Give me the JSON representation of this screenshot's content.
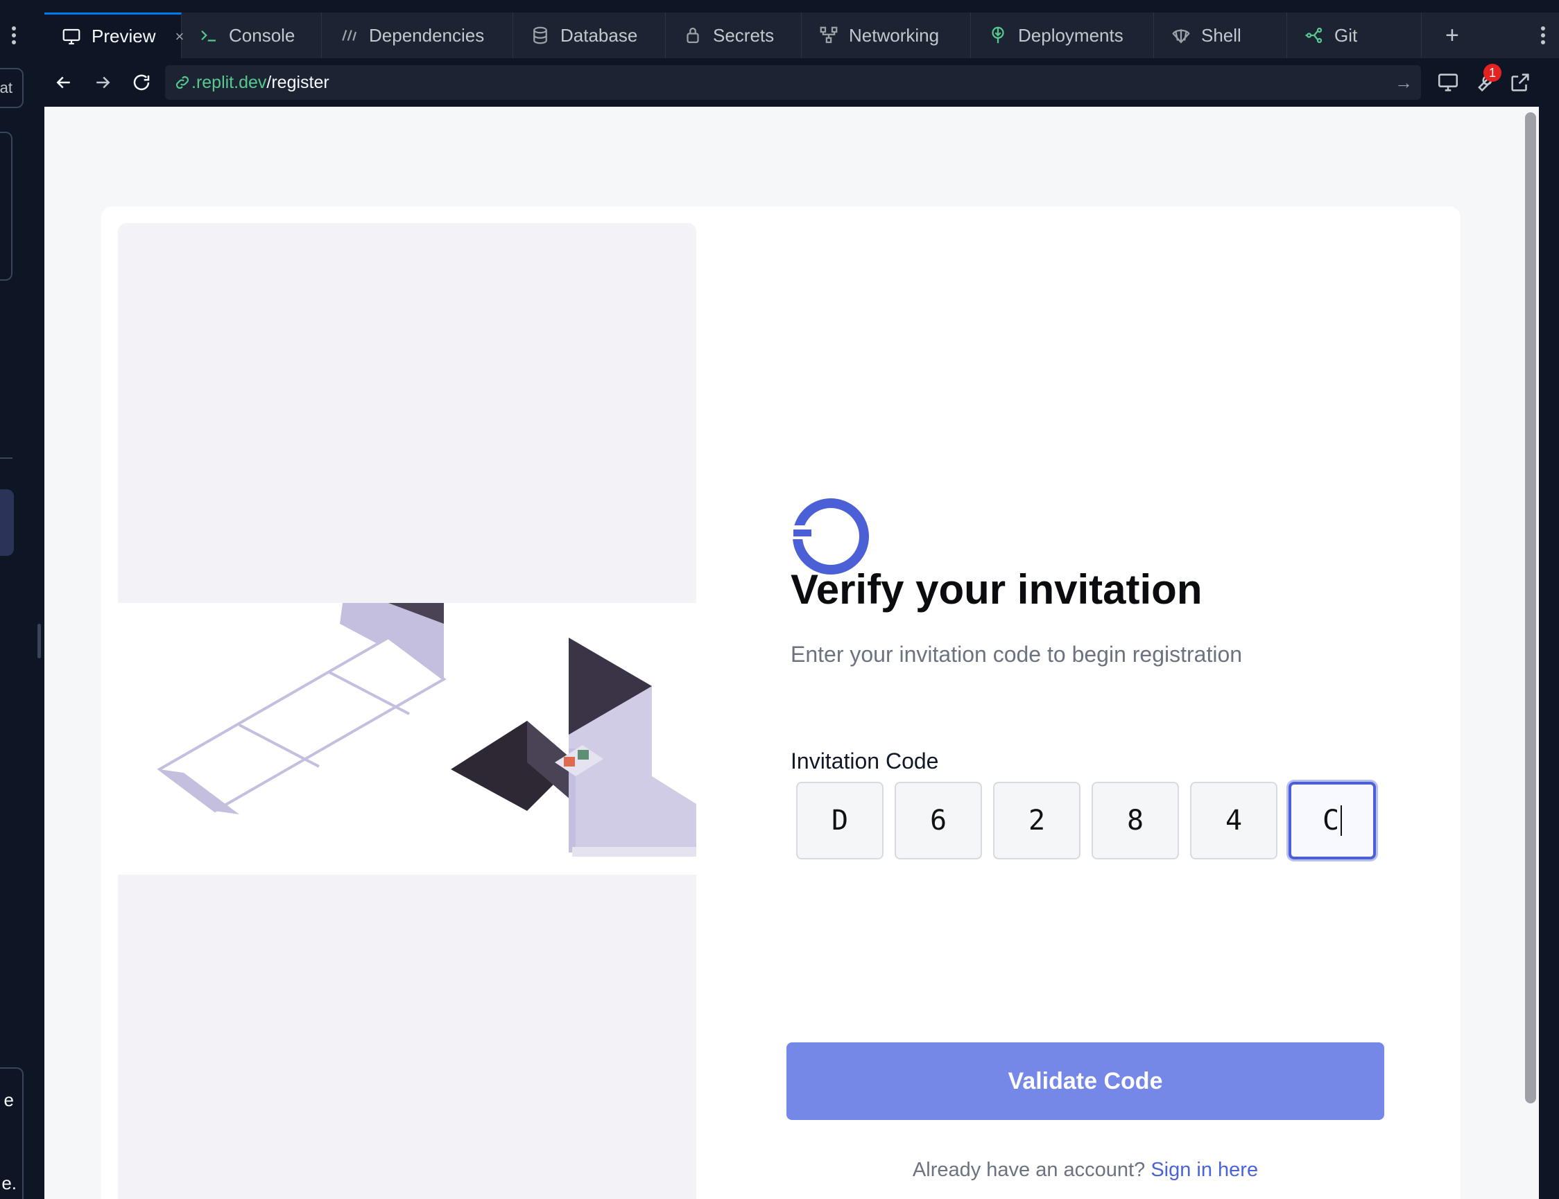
{
  "ide": {
    "rail": {
      "chip_text": "at",
      "bottom_line1": "e",
      "bottom_line2": "e."
    },
    "tabs": [
      {
        "label": "Preview",
        "icon": "monitor-icon",
        "active": true,
        "closable": true
      },
      {
        "label": "Console",
        "icon": "terminal-icon"
      },
      {
        "label": "Dependencies",
        "icon": "dependencies-icon"
      },
      {
        "label": "Database",
        "icon": "database-icon"
      },
      {
        "label": "Secrets",
        "icon": "lock-icon"
      },
      {
        "label": "Networking",
        "icon": "network-icon"
      },
      {
        "label": "Deployments",
        "icon": "deployments-icon"
      },
      {
        "label": "Shell",
        "icon": "shell-icon"
      },
      {
        "label": "Git",
        "icon": "git-icon"
      }
    ],
    "tab_close": "×",
    "tab_add": "+",
    "url": {
      "host": ".replit.dev",
      "path": "/register"
    },
    "devtools_badge": "1"
  },
  "page": {
    "title": "Verify your invitation",
    "subtitle": "Enter your invitation code to begin registration",
    "code_label": "Invitation Code",
    "code": [
      "D",
      "6",
      "2",
      "8",
      "4",
      "C"
    ],
    "focused_index": 5,
    "validate_label": "Validate Code",
    "signin_prompt": "Already have an account?",
    "signin_link": "Sign in here"
  },
  "colors": {
    "ide_bg": "#0e1525",
    "tab_bg": "#1c2333",
    "url_host": "#58c98e",
    "brand": "#4b5fd6",
    "button": "#7588e8",
    "link": "#4b63d8"
  }
}
